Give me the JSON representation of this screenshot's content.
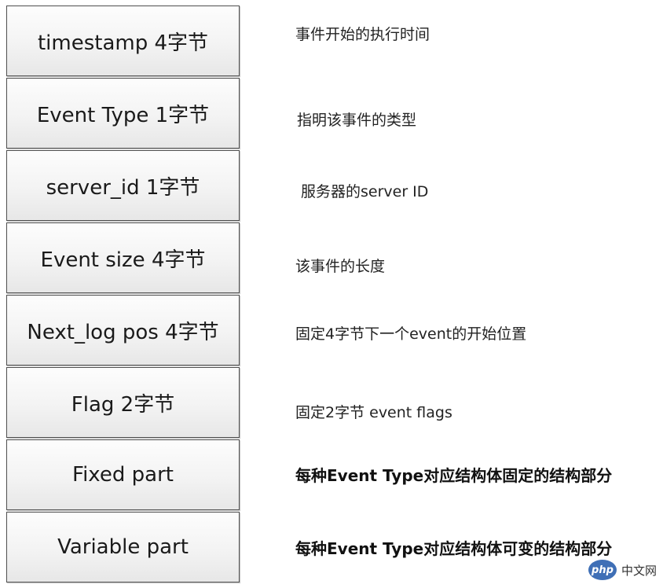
{
  "fields": [
    {
      "label": "timestamp 4字节",
      "desc": "事件开始的执行时间"
    },
    {
      "label": "Event Type 1字节",
      "desc": "指明该事件的类型"
    },
    {
      "label": "server_id 1字节",
      "desc": "服务器的server ID"
    },
    {
      "label": "Event size  4字节",
      "desc": "该事件的长度"
    },
    {
      "label": "Next_log pos 4字节",
      "desc": "固定4字节下一个event的开始位置"
    },
    {
      "label": "Flag 2字节",
      "desc": "固定2字节 event flags"
    },
    {
      "label": "Fixed part",
      "desc": "每种Event Type对应结构体固定的结构部分"
    },
    {
      "label": "Variable part",
      "desc": "每种Event Type对应结构体可变的结构部分"
    }
  ],
  "watermark": {
    "logo": "php",
    "site": "中文网"
  },
  "colors": {
    "box_border": "#4f4f4f",
    "box_fill_top": "#fdfdfd",
    "box_fill_bottom": "#e7e7e7",
    "watermark_logo": "#3f6fb6"
  }
}
